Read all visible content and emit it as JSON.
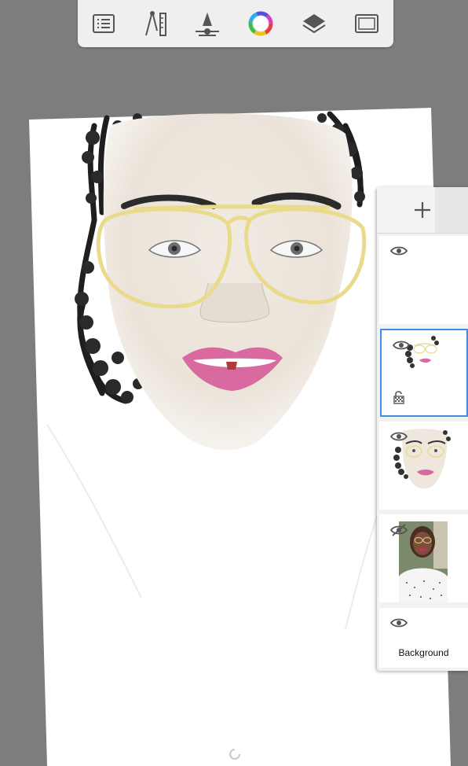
{
  "toolbar": {
    "tools": [
      {
        "name": "layers-list-icon"
      },
      {
        "name": "ruler-compass-icon"
      },
      {
        "name": "brush-size-icon"
      },
      {
        "name": "color-wheel-icon"
      },
      {
        "name": "layers-stack-icon"
      },
      {
        "name": "canvas-frame-icon"
      }
    ]
  },
  "layers_panel": {
    "add_icon": "plus-icon",
    "layers": [
      {
        "visible": true,
        "locked": false,
        "selected": false,
        "label": ""
      },
      {
        "visible": true,
        "locked": true,
        "selected": true,
        "label": ""
      },
      {
        "visible": true,
        "locked": false,
        "selected": false,
        "label": ""
      },
      {
        "visible": false,
        "locked": false,
        "selected": false,
        "label": ""
      },
      {
        "visible": true,
        "locked": false,
        "selected": false,
        "label": "Background"
      }
    ]
  },
  "colors": {
    "background": "#7d7d7d",
    "selection": "#3f8ee6",
    "glasses": "#eadb8c",
    "lips": "#d96aa0",
    "skin": "#efe7de"
  }
}
